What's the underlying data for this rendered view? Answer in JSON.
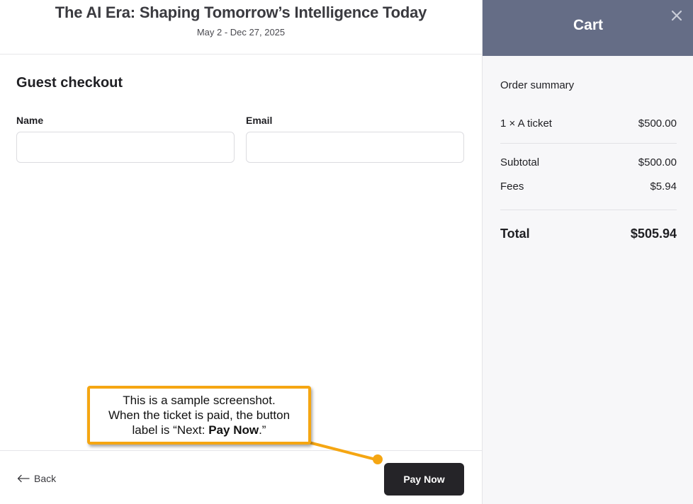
{
  "event": {
    "title": "The AI Era: Shaping Tomorrow’s Intelligence Today",
    "dates": "May 2 - Dec 27, 2025"
  },
  "checkout": {
    "title": "Guest checkout",
    "name_label": "Name",
    "name_value": "",
    "email_label": "Email",
    "email_value": ""
  },
  "footer": {
    "back_label": "Back",
    "pay_label": "Pay Now"
  },
  "cart": {
    "title": "Cart",
    "summary_title": "Order summary",
    "line_item": {
      "label": "1 × A ticket",
      "price": "$500.00"
    },
    "subtotal": {
      "label": "Subtotal",
      "value": "$500.00"
    },
    "fees": {
      "label": "Fees",
      "value": "$5.94"
    },
    "total": {
      "label": "Total",
      "value": "$505.94"
    }
  },
  "callout": {
    "line1": "This is a sample screenshot.",
    "line2": "When the ticket is paid, the button",
    "line3_prefix": "label is “Next: ",
    "line3_bold": "Pay Now",
    "line3_suffix": ".”"
  },
  "colors": {
    "cart_header": "#656d86",
    "pay_button": "#252428",
    "callout_border": "#f5a612"
  },
  "icons": [
    "close-icon",
    "arrow-left-icon"
  ]
}
